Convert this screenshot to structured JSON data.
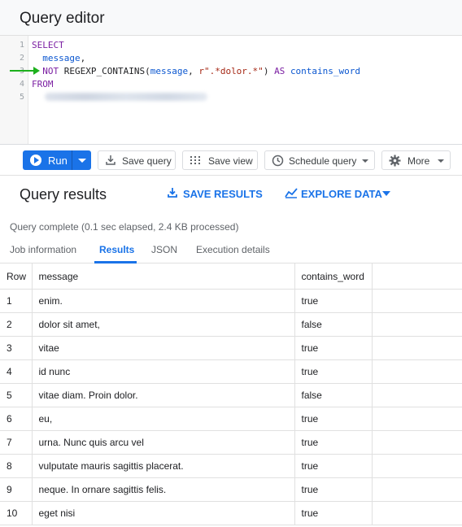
{
  "editor": {
    "title": "Query editor",
    "line_numbers": [
      "1",
      "2",
      "3",
      "4",
      "5"
    ],
    "code": {
      "l1_select": "SELECT",
      "l2_message": "message",
      "l2_comma": ",",
      "l3_not": "NOT",
      "l3_fn": "REGEXP_CONTAINS(",
      "l3_arg": "message",
      "l3_sep": ", ",
      "l3_str": "r\".*dolor.*\"",
      "l3_close": ") ",
      "l3_as": "AS",
      "l3_alias": "contains_word",
      "l4_from": "FROM"
    }
  },
  "toolbar": {
    "run": "Run",
    "save_query": "Save query",
    "save_view": "Save view",
    "schedule_query": "Schedule query",
    "more": "More"
  },
  "results": {
    "title": "Query results",
    "save_results": "SAVE RESULTS",
    "explore_data": "EXPLORE DATA",
    "status": "Query complete (0.1 sec elapsed, 2.4 KB processed)",
    "tabs": [
      "Job information",
      "Results",
      "JSON",
      "Execution details"
    ],
    "columns": [
      "Row",
      "message",
      "contains_word",
      ""
    ],
    "rows": [
      [
        "1",
        "enim.",
        "true"
      ],
      [
        "2",
        "dolor sit amet,",
        "false"
      ],
      [
        "3",
        "vitae",
        "true"
      ],
      [
        "4",
        "id nunc",
        "true"
      ],
      [
        "5",
        "vitae diam. Proin dolor.",
        "false"
      ],
      [
        "6",
        "eu,",
        "true"
      ],
      [
        "7",
        "urna. Nunc quis arcu vel",
        "true"
      ],
      [
        "8",
        "vulputate mauris sagittis placerat.",
        "true"
      ],
      [
        "9",
        "neque. In ornare sagittis felis.",
        "true"
      ],
      [
        "10",
        "eget nisi",
        "true"
      ]
    ]
  },
  "colors": {
    "accent": "#1a73e8",
    "keyword": "#7b1fa2",
    "string": "#a52714",
    "arrow": "#1db01d"
  }
}
